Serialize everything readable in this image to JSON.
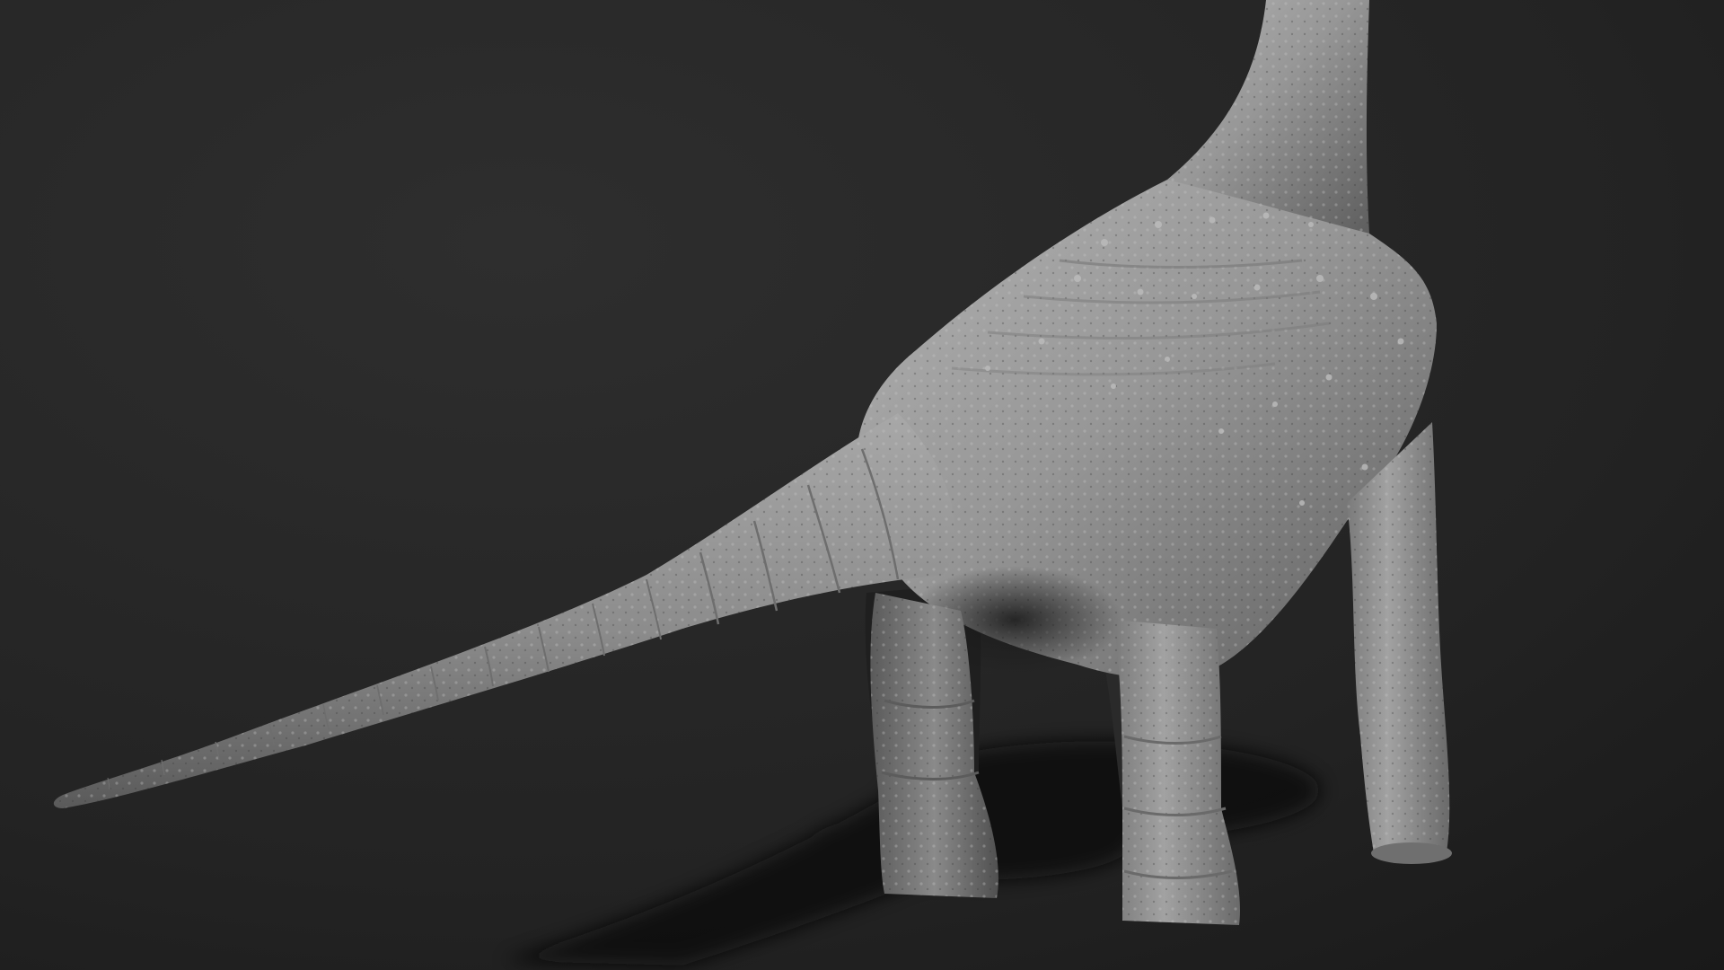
{
  "scene": {
    "subject_icon": "dinosaur-sculpt-icon",
    "colors": {
      "background_top": "#2b2b2b",
      "background_bottom": "#171717",
      "skin_light": "#a9a9a9",
      "skin_mid": "#8a8a8a",
      "skin_dark": "#4a4a4a",
      "shadow": "#0b0b0b"
    }
  }
}
